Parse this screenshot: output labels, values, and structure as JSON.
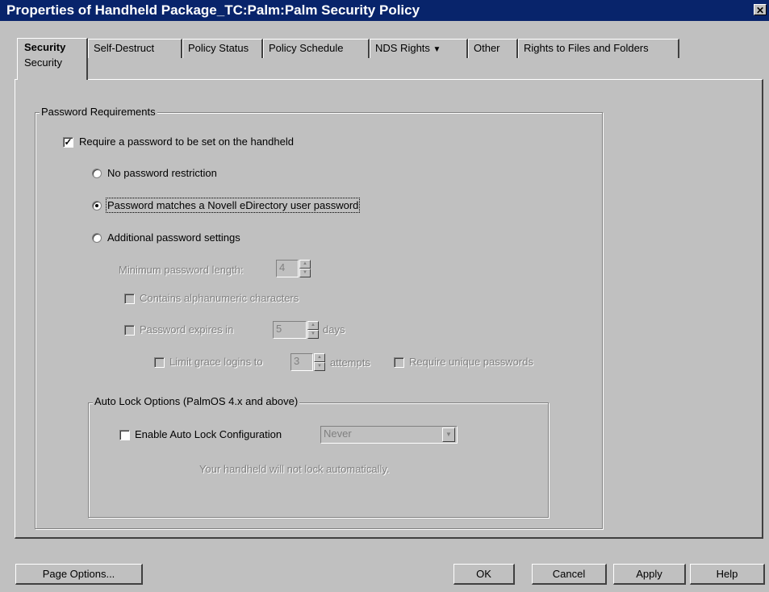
{
  "window": {
    "title": "Properties of Handheld Package_TC:Palm:Palm Security Policy",
    "close_glyph": "✕"
  },
  "tabs": [
    {
      "label": "Security",
      "sublabel": "Security",
      "selected": true
    },
    {
      "label": "Self-Destruct"
    },
    {
      "label": "Policy Status"
    },
    {
      "label": "Policy Schedule"
    },
    {
      "label": "NDS Rights",
      "dropdown_glyph": "▼"
    },
    {
      "label": "Other"
    },
    {
      "label": "Rights to Files and Folders"
    }
  ],
  "password_group": {
    "legend": "Password Requirements",
    "require_password": {
      "label": "Require a password to be set on the handheld",
      "checked": true
    },
    "options": [
      {
        "label": "No password restriction",
        "selected": false
      },
      {
        "label": "Password matches a Novell eDirectory user password",
        "selected": true
      },
      {
        "label": "Additional password settings",
        "selected": false
      }
    ],
    "min_length": {
      "label": "Minimum password length:",
      "value": "4"
    },
    "alphanumeric": {
      "label": "Contains alphanumeric characters"
    },
    "expires": {
      "label": "Password expires in",
      "value": "5",
      "unit": "days"
    },
    "grace": {
      "label": "Limit grace logins to",
      "value": "3",
      "unit": "attempts"
    },
    "unique": {
      "label": "Require unique passwords"
    }
  },
  "autolock_group": {
    "legend": "Auto Lock Options (PalmOS 4.x and above)",
    "enable": {
      "label": "Enable Auto Lock Configuration",
      "checked": false
    },
    "select_value": "Never",
    "status": "Your handheld will not lock automatically."
  },
  "buttons": {
    "page_options": "Page Options...",
    "ok": "OK",
    "cancel": "Cancel",
    "apply": "Apply",
    "help": "Help"
  },
  "colors": {
    "titlebar": "#08246b",
    "face": "#c0c0c0",
    "disabled": "#808080"
  }
}
